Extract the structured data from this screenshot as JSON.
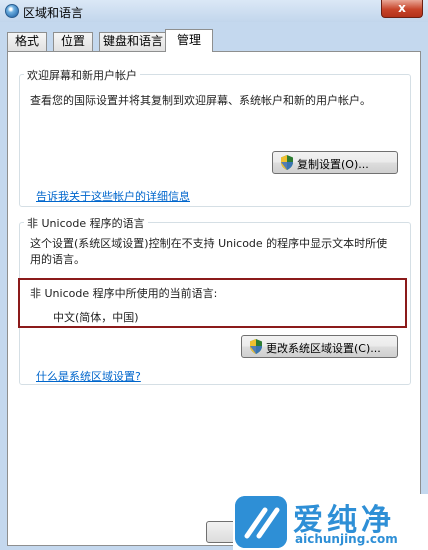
{
  "window": {
    "title": "区域和语言",
    "close_symbol": "x"
  },
  "tabs": [
    {
      "label": "格式",
      "active": false
    },
    {
      "label": "位置",
      "active": false
    },
    {
      "label": "键盘和语言",
      "active": false
    },
    {
      "label": "管理",
      "active": true
    }
  ],
  "welcome_group": {
    "title": "欢迎屏幕和新用户帐户",
    "description": "查看您的国际设置并将其复制到欢迎屏幕、系统帐户和新的用户帐户。",
    "copy_button": "复制设置(O)...",
    "link": "告诉我关于这些帐户的详细信息"
  },
  "unicode_group": {
    "title": "非 Unicode 程序的语言",
    "description_line1": "这个设置(系统区域设置)控制在不支持 Unicode 的程序中显示文本时所使",
    "description_line2": "用的语言。",
    "current_label": "非 Unicode 程序中所使用的当前语言:",
    "current_value": "中文(简体，中国)",
    "change_button": "更改系统区域设置(C)...",
    "link": "什么是系统区域设置?"
  },
  "watermark": {
    "brand": "爱纯净",
    "url": "aichunjing.com"
  },
  "colors": {
    "highlight_border": "#8b1a1a",
    "link": "#0066cc",
    "shield": "#2e7d32"
  }
}
